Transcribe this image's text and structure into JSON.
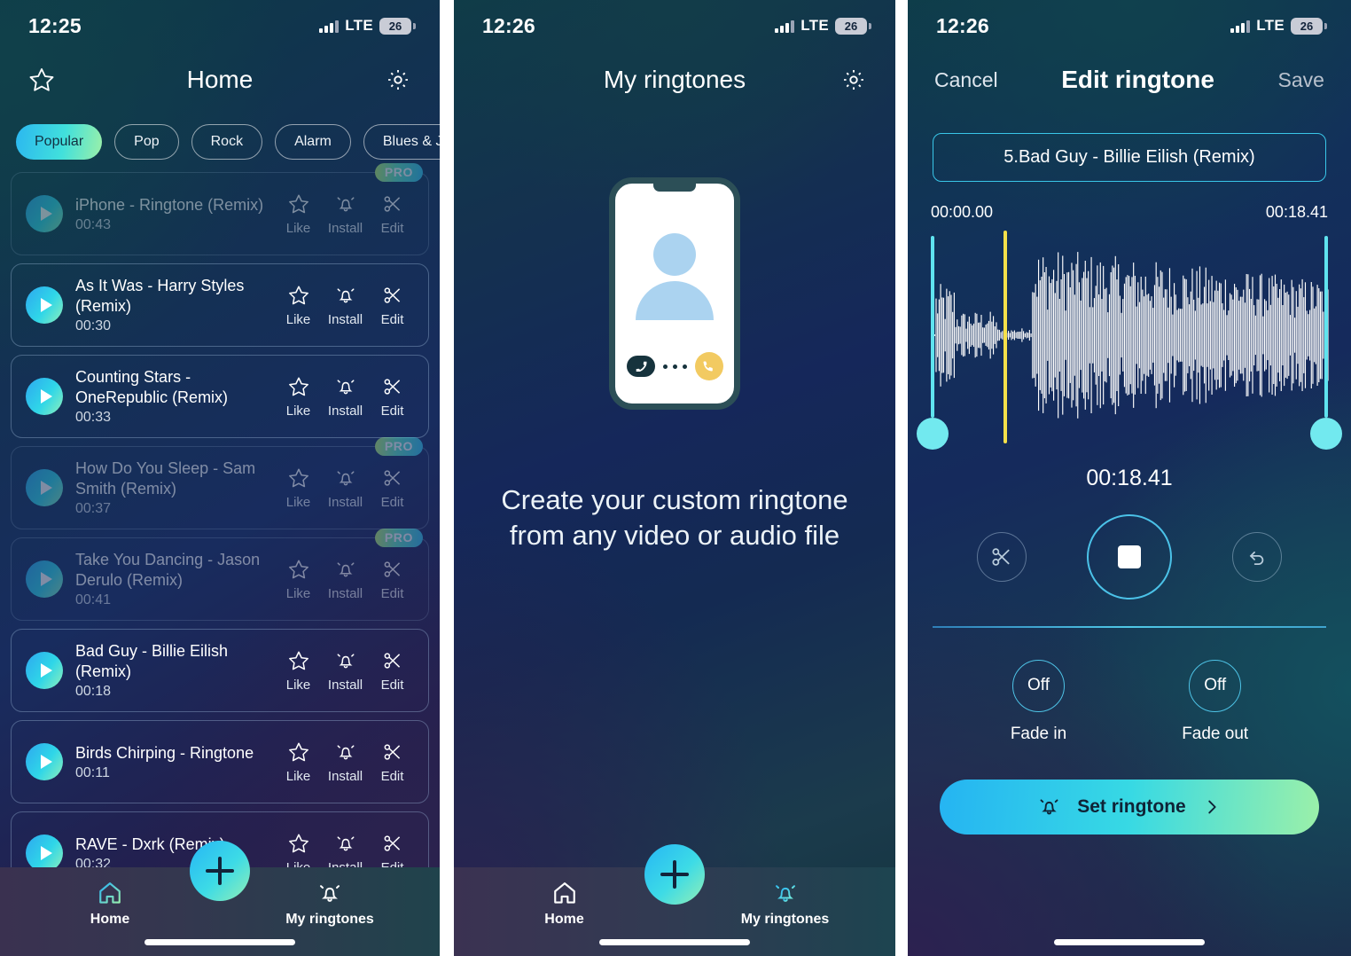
{
  "accent": {
    "cyan": "#3ddbe6",
    "green": "#93efb5",
    "blue": "#26b6f5",
    "playhead_yellow": "#f5e04a",
    "handle": "#72e9ef",
    "pro_badge_gradient": "#bdf06f"
  },
  "home_screen": {
    "status": {
      "time": "12:25",
      "network": "LTE",
      "battery": "26"
    },
    "nav": {
      "title": "Home",
      "left_icon": "star-icon",
      "right_icon": "gear-icon"
    },
    "chips": [
      {
        "label": "Popular",
        "active": true
      },
      {
        "label": "Pop",
        "active": false
      },
      {
        "label": "Rock",
        "active": false
      },
      {
        "label": "Alarm",
        "active": false
      },
      {
        "label": "Blues & Ja",
        "active": false
      }
    ],
    "action_labels": {
      "like": "Like",
      "install": "Install",
      "edit": "Edit"
    },
    "pro_label": "PRO",
    "items": [
      {
        "title": "iPhone - Ringtone (Remix)",
        "duration": "00:43",
        "pro": true
      },
      {
        "title": "As It Was - Harry Styles (Remix)",
        "duration": "00:30",
        "pro": false
      },
      {
        "title": "Counting Stars - OneRepublic (Remix)",
        "duration": "00:33",
        "pro": false
      },
      {
        "title": "How Do You Sleep - Sam Smith (Remix)",
        "duration": "00:37",
        "pro": true
      },
      {
        "title": "Take You Dancing - Jason Derulo (Remix)",
        "duration": "00:41",
        "pro": true
      },
      {
        "title": "Bad Guy - Billie Eilish (Remix)",
        "duration": "00:18",
        "pro": false
      },
      {
        "title": "Birds Chirping - Ringtone",
        "duration": "00:11",
        "pro": false
      },
      {
        "title": "RAVE - Dxrk (Remix)",
        "duration": "00:32",
        "pro": false
      }
    ],
    "tabs": [
      {
        "label": "Home",
        "icon": "home-icon",
        "active": true
      },
      {
        "label": "My ringtones",
        "icon": "bell-icon",
        "active": false
      }
    ],
    "fab": {
      "icon": "plus-icon"
    }
  },
  "my_ringtones_screen": {
    "status": {
      "time": "12:26",
      "network": "LTE",
      "battery": "26"
    },
    "nav": {
      "title": "My ringtones",
      "right_icon": "gear-icon"
    },
    "empty_text_line1": "Create your custom ringtone",
    "empty_text_line2": "from any video or audio file",
    "illustration": "incoming-call-phone",
    "tabs": [
      {
        "label": "Home",
        "icon": "home-icon",
        "active": false
      },
      {
        "label": "My ringtones",
        "icon": "bell-icon",
        "active": true
      }
    ],
    "fab": {
      "icon": "plus-icon"
    }
  },
  "edit_screen": {
    "status": {
      "time": "12:26",
      "network": "LTE",
      "battery": "26"
    },
    "nav": {
      "cancel": "Cancel",
      "title": "Edit ringtone",
      "save": "Save"
    },
    "track_name": "5.Bad Guy - Billie Eilish (Remix)",
    "waveform": {
      "start_time": "00:00.00",
      "end_time": "00:18.41",
      "playhead_percent": 20,
      "selection_start_percent": 2,
      "selection_end_percent": 96
    },
    "current_time": "00:18.41",
    "transport": [
      {
        "name": "trim-button",
        "icon": "scissors-icon"
      },
      {
        "name": "stop-button",
        "icon": "stop-icon"
      },
      {
        "name": "undo-button",
        "icon": "undo-icon"
      }
    ],
    "fade_in": {
      "value": "Off",
      "label": "Fade in"
    },
    "fade_out": {
      "value": "Off",
      "label": "Fade out"
    },
    "set_button": {
      "label": "Set ringtone",
      "icon": "bell-icon",
      "chevron": "chevron-right-icon"
    }
  }
}
